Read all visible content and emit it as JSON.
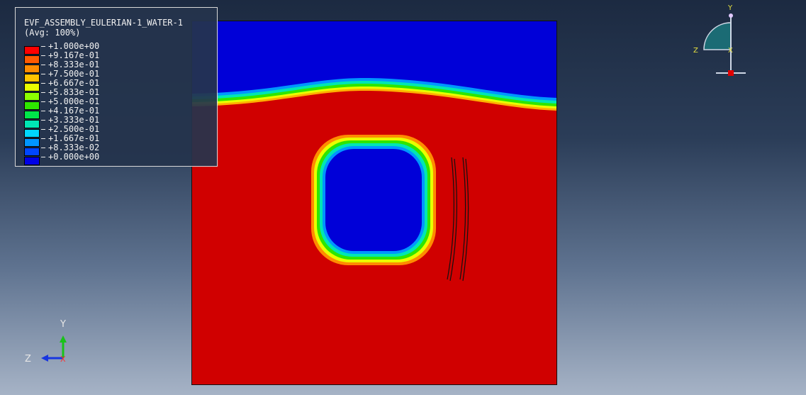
{
  "viewport": {
    "legend": {
      "title": "EVF_ASSEMBLY_EULERIAN-1_WATER-1",
      "subtitle": "(Avg: 100%)",
      "entries": [
        {
          "label": "+1.000e+00",
          "color": "#ff0000"
        },
        {
          "label": "+9.167e-01",
          "color": "#ff5a00"
        },
        {
          "label": "+8.333e-01",
          "color": "#ff8c00"
        },
        {
          "label": "+7.500e-01",
          "color": "#ffc400"
        },
        {
          "label": "+6.667e-01",
          "color": "#e8ff00"
        },
        {
          "label": "+5.833e-01",
          "color": "#8cff00"
        },
        {
          "label": "+5.000e-01",
          "color": "#2ee600"
        },
        {
          "label": "+4.167e-01",
          "color": "#00e64a"
        },
        {
          "label": "+3.333e-01",
          "color": "#00e6b4"
        },
        {
          "label": "+2.500e-01",
          "color": "#00d7ff"
        },
        {
          "label": "+1.667e-01",
          "color": "#0096ff"
        },
        {
          "label": "+8.333e-02",
          "color": "#0046ff"
        },
        {
          "label": "+0.000e+00",
          "color": "#0000e6"
        }
      ]
    },
    "model": {
      "colors": {
        "water": "#d00000",
        "void": "#0000d8"
      },
      "name": "eulerian-contour-plot"
    },
    "triad_left": {
      "y_label": "Y",
      "z_label": "Z",
      "x_label": "X"
    },
    "triad_right": {
      "y_label": "Y",
      "z_label": "Z",
      "x_label": "X"
    }
  }
}
